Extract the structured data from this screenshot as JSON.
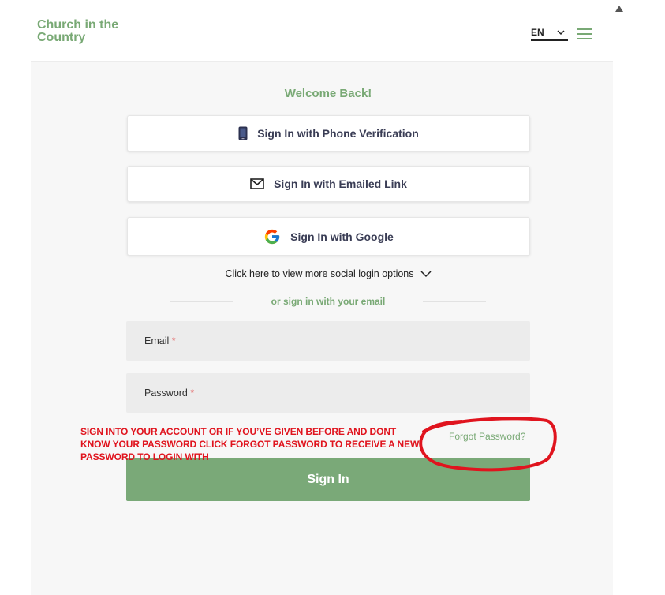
{
  "header": {
    "brand_line1": "Church in the",
    "brand_line2": "Country",
    "language": "EN"
  },
  "login": {
    "welcome": "Welcome Back!",
    "phone_button": "Sign In with Phone Verification",
    "email_link_button": "Sign In with Emailed Link",
    "google_button": "Sign In with Google",
    "more_social": "Click here to view more social login options",
    "divider_text": "or sign in with your email",
    "email_label": "Email",
    "password_label": "Password",
    "required_mark": "*",
    "forgot_password": "Forgot Password?",
    "sign_in_button": "Sign In"
  },
  "annotation": {
    "note": "SIGN INTO YOUR ACCOUNT OR IF YOU’VE GIVEN BEFORE AND DONT KNOW YOUR PASSWORD CLICK FORGOT PASSWORD TO RECEIVE A NEW PASSWORD TO LOGIN WITH",
    "color": "#e0141e"
  },
  "colors": {
    "brand_green": "#79a975",
    "button_text": "#3a3d55",
    "field_bg": "#ececec"
  },
  "icons": [
    "phone-icon",
    "mail-icon",
    "google-icon",
    "chevron-down-icon",
    "hamburger-menu-icon",
    "scroll-up-icon"
  ]
}
